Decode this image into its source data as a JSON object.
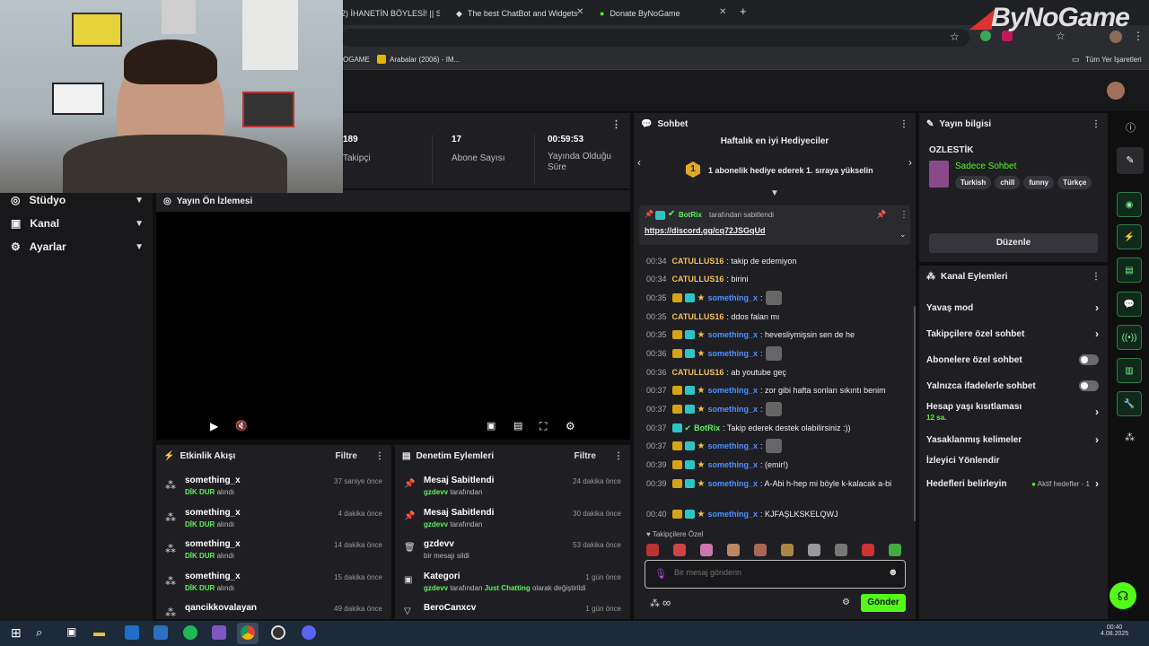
{
  "browser": {
    "tabs": [
      {
        "label": "2) İHANETİN BÖYLESİ! || S..."
      },
      {
        "label": "The best ChatBot and Widgets"
      },
      {
        "label": "Donate ByNoGame"
      }
    ],
    "new_tab": "+",
    "bookmarks": [
      {
        "label": "OGAME"
      },
      {
        "label": "Arabalar (2006) - IM..."
      }
    ],
    "all_bookmarks": "Tüm Yer İşaretleri"
  },
  "watermark": "ByNoGame",
  "left_nav": {
    "items": [
      {
        "label": "Stüdyo",
        "icon": "studio-icon"
      },
      {
        "label": "Kanal",
        "icon": "channel-icon"
      },
      {
        "label": "Ayarlar",
        "icon": "gear-icon"
      }
    ]
  },
  "stats": [
    {
      "value": "189",
      "label": "Takipçi"
    },
    {
      "value": "17",
      "label": "Abone Sayısı"
    },
    {
      "value": "00:59:53",
      "label": "Yayında Olduğu Süre"
    }
  ],
  "preview": {
    "title": "Yayın Ön İzlemesi"
  },
  "activity": {
    "title": "Etkinlik Akışı",
    "filter": "Filtre",
    "items": [
      {
        "name": "something_x",
        "action": "DİK DUR",
        "suffix": "alındı",
        "time": "37 saniye önce"
      },
      {
        "name": "something_x",
        "action": "DİK DUR",
        "suffix": "alındı",
        "time": "4 dakika önce"
      },
      {
        "name": "something_x",
        "action": "DİK DUR",
        "suffix": "alındı",
        "time": "14 dakika önce"
      },
      {
        "name": "something_x",
        "action": "DİK DUR",
        "suffix": "alındı",
        "time": "15 dakika önce"
      },
      {
        "name": "qancikkovalayan",
        "action": "",
        "suffix": "",
        "time": "49 dakika önce"
      }
    ]
  },
  "moderation": {
    "title": "Denetim Eylemleri",
    "filter": "Filtre",
    "items": [
      {
        "name": "Mesaj Sabitlendi",
        "user": "gzdevv",
        "text": "tarafından",
        "time": "24 dakika önce",
        "icon": "pin-icon"
      },
      {
        "name": "Mesaj Sabitlendi",
        "user": "gzdevv",
        "text": "tarafından",
        "time": "30 dakika önce",
        "icon": "pin-icon"
      },
      {
        "name": "gzdevv",
        "user": "",
        "text": "bir mesajı sildi",
        "time": "53 dakika önce",
        "icon": "trash-icon"
      },
      {
        "name": "Kategori",
        "user": "gzdevv",
        "text": "tarafından",
        "category": "Just Chatting",
        "text2": "olarak değiştirildi",
        "time": "1 gün önce",
        "icon": "category-icon"
      },
      {
        "name": "BeroCanxcv",
        "user": "",
        "text": "",
        "time": "1 gün önce",
        "icon": "filter-icon"
      }
    ]
  },
  "chat": {
    "title": "Sohbet",
    "gifters_title": "Haftalık en iyi Hediyeciler",
    "gifters_rank": "1",
    "gifters_text": "1 abonelik hediye ederek 1. sıraya yükselin",
    "pinned": {
      "user": "BotRix",
      "by": "tarafından sabitlendi",
      "link": "https://discord.gg/cq72JSGqUd"
    },
    "messages": [
      {
        "time": "00:34",
        "user": "CATULLUS16",
        "text": ": takip de edemiyon",
        "color": "gold",
        "badges": false
      },
      {
        "time": "00:34",
        "user": "CATULLUS16",
        "text": ": birini",
        "color": "gold",
        "badges": false
      },
      {
        "time": "00:35",
        "user": "something_x",
        "text": ":",
        "color": "blue",
        "badges": true,
        "emote": true
      },
      {
        "time": "00:35",
        "user": "CATULLUS16",
        "text": ": ddos falan mı",
        "color": "gold",
        "badges": false
      },
      {
        "time": "00:35",
        "user": "something_x",
        "text": ": hevesliymişsin sen de he",
        "color": "blue",
        "badges": true
      },
      {
        "time": "00:36",
        "user": "something_x",
        "text": ":",
        "color": "blue",
        "badges": true,
        "emote": true
      },
      {
        "time": "00:36",
        "user": "CATULLUS16",
        "text": ": ab youtube geç",
        "color": "gold",
        "badges": false
      },
      {
        "time": "00:37",
        "user": "something_x",
        "text": ": zor gibi hafta sonları sıkıntı benim",
        "color": "blue",
        "badges": true
      },
      {
        "time": "00:37",
        "user": "something_x",
        "text": ":",
        "color": "blue",
        "badges": true,
        "emote": true
      },
      {
        "time": "00:37",
        "user": "BotRix",
        "text": ": Takip ederek destek olabilirsiniz :))",
        "color": "green",
        "badges": false
      },
      {
        "time": "00:37",
        "user": "something_x",
        "text": ":",
        "color": "blue",
        "badges": true,
        "emote": true
      },
      {
        "time": "00:39",
        "user": "something_x",
        "text": ": (emir!)",
        "color": "blue",
        "badges": true
      },
      {
        "time": "00:39",
        "user": "something_x",
        "text": ": A-Abi h-hep mi böyle k-kalacak a-bi",
        "color": "blue",
        "badges": true
      },
      {
        "time": "00:40",
        "user": "something_x",
        "text": ": KJFAŞLKSKELQWJ",
        "color": "blue",
        "badges": true
      }
    ],
    "followers_only": "Takipçilere Özel",
    "input_placeholder": "Bir mesaj gönderin",
    "send": "Gönder"
  },
  "stream_info": {
    "title": "Yayın bilgisi",
    "channel": "OZLESTİK",
    "category": "Sadece Sohbet",
    "tags": [
      "Turkish",
      "chill",
      "funny",
      "Türkçe"
    ],
    "edit": "Düzenle"
  },
  "channel_actions": {
    "title": "Kanal Eylemleri",
    "rows": [
      {
        "label": "Yavaş mod",
        "kind": "arrow"
      },
      {
        "label": "Takipçilere özel sohbet",
        "kind": "arrow"
      },
      {
        "label": "Abonelere özel sohbet",
        "kind": "toggle"
      },
      {
        "label": "Yalnızca ifadelerle sohbet",
        "kind": "toggle"
      },
      {
        "label": "Hesap yaşı kısıtlaması",
        "sub": "12 sa.",
        "kind": "arrow"
      },
      {
        "label": "Yasaklanmış kelimeler",
        "kind": "arrow"
      },
      {
        "label": "İzleyici Yönlendir",
        "kind": "none"
      },
      {
        "label": "Hedefleri belirleyin",
        "sub": "Aktif hedefler - 1",
        "kind": "arrow"
      }
    ]
  },
  "taskbar": {
    "time": "00:40",
    "date": "4.08.2025"
  },
  "colors": {
    "accent": "#53fc18",
    "bg": "#0f0f0f",
    "panel": "#1f1f23"
  }
}
